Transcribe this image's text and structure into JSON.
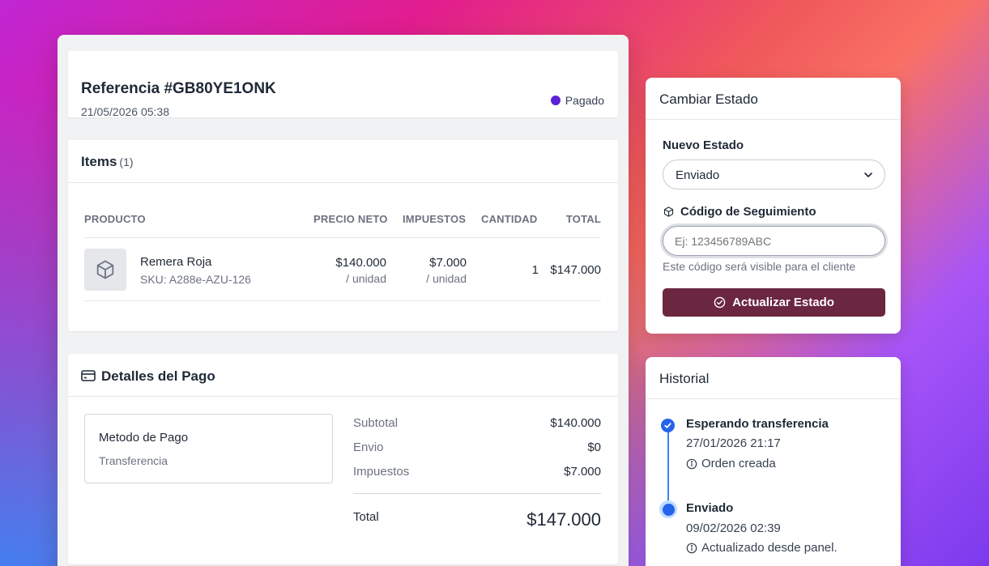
{
  "order": {
    "reference": "Referencia #GB80YE1ONK",
    "date": "21/05/2026 05:38",
    "status": "Pagado",
    "status_color": "#5b21d6"
  },
  "items": {
    "title": "Items",
    "count": "(1)",
    "columns": [
      "PRODUCTO",
      "PRECIO NETO",
      "IMPUESTOS",
      "CANTIDAD",
      "TOTAL"
    ],
    "rows": [
      {
        "name": "Remera Roja",
        "sku": "SKU: A288e-AZU-126",
        "price": "$140.000",
        "price_unit": "/ unidad",
        "tax": "$7.000",
        "tax_unit": "/ unidad",
        "qty": "1",
        "total": "$147.000",
        "icon": "box-icon"
      }
    ]
  },
  "payment": {
    "title": "Detalles del Pago",
    "method_label": "Metodo de Pago",
    "method_value": "Transferencia",
    "subtotal_label": "Subtotal",
    "subtotal_value": "$140.000",
    "shipping_label": "Envio",
    "shipping_value": "$0",
    "tax_label": "Impuestos",
    "tax_value": "$7.000",
    "total_label": "Total",
    "total_value": "$147.000"
  },
  "change_state": {
    "title": "Cambiar Estado",
    "new_state_label": "Nuevo Estado",
    "selected_state": "Enviado",
    "tracking_label": "Código de Seguimiento",
    "tracking_placeholder": "Ej: 123456789ABC",
    "tracking_value": "",
    "hint": "Este código será visible para el cliente",
    "button_label": "Actualizar Estado",
    "button_color": "#6b2640"
  },
  "history": {
    "title": "Historial",
    "events": [
      {
        "title": "Esperando transferencia",
        "date": "27/01/2026 21:17",
        "note": "Orden creada"
      },
      {
        "title": "Enviado",
        "date": "09/02/2026 02:39",
        "note": "Actualizado desde panel."
      }
    ],
    "accent": "#2563eb"
  }
}
